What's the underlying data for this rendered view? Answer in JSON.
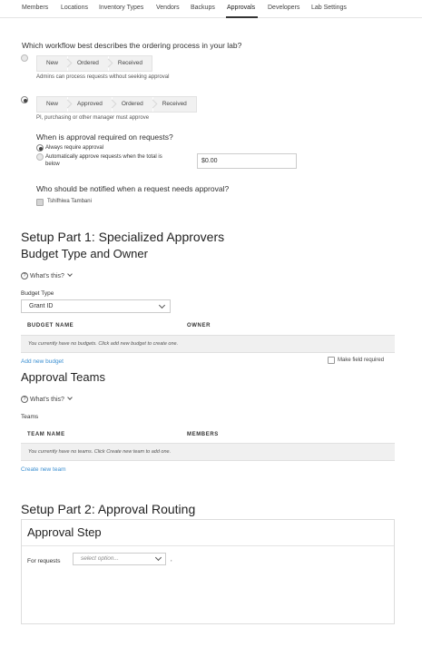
{
  "nav": {
    "tabs": [
      "Members",
      "Locations",
      "Inventory Types",
      "Vendors",
      "Backups",
      "Approvals",
      "Developers",
      "Lab Settings"
    ],
    "active": "Approvals"
  },
  "workflow": {
    "question": "Which workflow best describes the ordering process in your lab?",
    "option1": {
      "steps": [
        "New",
        "Ordered",
        "Received"
      ],
      "description": "Admins can process requests without seeking approval",
      "selected": false
    },
    "option2": {
      "steps": [
        "New",
        "Approved",
        "Ordered",
        "Received"
      ],
      "description": "PI, purchasing or other manager must approve",
      "selected": true
    }
  },
  "approval_required": {
    "question": "When is approval required on requests?",
    "always": "Always require approval",
    "auto_line1": "Automatically approve requests when the total is",
    "auto_line2": "below",
    "amount": "$0.00"
  },
  "notify": {
    "question": "Who should be notified when a request needs approval?",
    "person": "Tshifhiwa Tambani"
  },
  "part1": {
    "title": "Setup Part 1: Specialized Approvers",
    "budget_heading": "Budget Type and Owner",
    "whats_this": "What's this?",
    "budget_type_label": "Budget Type",
    "budget_type_value": "Grant ID",
    "budget_columns": [
      "BUDGET NAME",
      "OWNER"
    ],
    "budget_empty": "You currently have no budgets. Click add new budget to create one.",
    "add_budget": "Add new budget",
    "make_required": "Make field required",
    "teams_heading": "Approval Teams",
    "teams_label": "Teams",
    "team_columns": [
      "TEAM NAME",
      "MEMBERS"
    ],
    "teams_empty": "You currently have no teams. Click Create new team to add one.",
    "create_team": "Create new team"
  },
  "part2": {
    "title": "Setup Part 2: Approval Routing",
    "step_title": "Approval Step",
    "for_requests": "For requests",
    "select_placeholder": "select option...",
    "trailing": ","
  }
}
